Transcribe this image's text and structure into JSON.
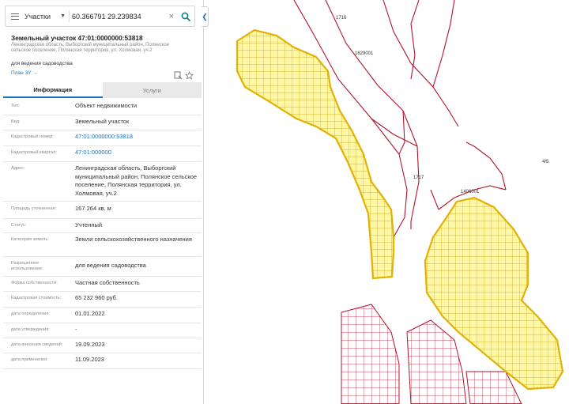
{
  "search": {
    "type_label": "Участки",
    "value": "60.366791 29.239834",
    "clear_symbol": "×"
  },
  "parcel": {
    "title": "Земельный участок 47:01:0000000:53818",
    "address_short": "Ленинградская область, Выборгский муниципальный район, Полянское сельское поселение, Полянская территория, ул. Холмовая, уч.2",
    "purpose": "для ведения садоводства",
    "plan_link": "План ЗУ →"
  },
  "tabs": {
    "info": "Информация",
    "services": "Услуги"
  },
  "fields": [
    {
      "label": "Тип:",
      "value": "Объект недвижимости"
    },
    {
      "label": "Вид:",
      "value": "Земельный участок"
    },
    {
      "label": "Кадастровый номер:",
      "value": "47:01:0000000:53818"
    },
    {
      "label": "Кадастровый квартал:",
      "value": "47:01:000000"
    },
    {
      "label": "Адрес:",
      "value": "Ленинградская область, Выборгский муниципальный район, Полянское сельское поселение, Полянская территория, ул. Холмовая, уч.2"
    },
    {
      "label": "Площадь уточненная:",
      "value": "167 264 кв. м"
    },
    {
      "label": "Статус:",
      "value": "Учтенный"
    },
    {
      "label": "Категория земель:",
      "value": "Земли сельскохозяйственного назначения"
    },
    {
      "label": "Разрешенное использование:",
      "value": "для ведения садоводства"
    },
    {
      "label": "Форма собственности:",
      "value": "Частная собственность"
    },
    {
      "label": "Кадастровая стоимость:",
      "value": "65 232 960 руб."
    },
    {
      "label": "дата определения:",
      "value": "01.01.2022"
    },
    {
      "label": "дата утверждения:",
      "value": "-"
    },
    {
      "label": "дата внесения сведений:",
      "value": "19.09.2023"
    },
    {
      "label": "дата применения:",
      "value": "11.09.2023"
    }
  ],
  "map": {
    "labels": {
      "l1716": "1716",
      "l1629001": "1629001",
      "l1717": "1717",
      "l1406001": "1406001",
      "l45": "4/5"
    },
    "colors": {
      "parcel_fill": "#fff7a6",
      "parcel_stroke": "#d9a400",
      "boundary": "#b3132b",
      "neighbour_fill": "#ffffff"
    }
  },
  "icons": {
    "menu": "menu-icon",
    "search": "search-icon",
    "print": "print-icon",
    "favorite": "star-icon",
    "collapse": "chevron-left-icon"
  }
}
